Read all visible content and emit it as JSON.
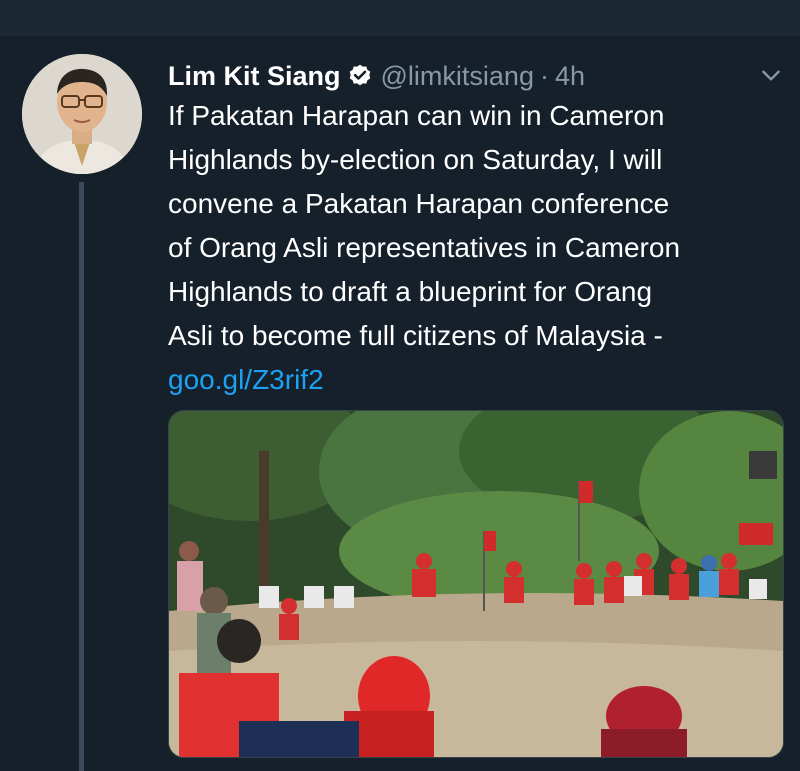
{
  "tweet": {
    "author_name": "Lim Kit Siang",
    "handle": "@limkitsiang",
    "separator": "·",
    "timestamp": "4h",
    "text_lines": [
      "If Pakatan Harapan can win in Cameron",
      "Highlands by-election on Saturday, I will",
      "convene a Pakatan Harapan conference",
      "of Orang Asli representatives in Cameron",
      "Highlands to draft a blueprint for Orang",
      "Asli to become full citizens of Malaysia -"
    ],
    "link": "goo.gl/Z3rif2",
    "icons": {
      "verified": "verified-badge-icon",
      "menu": "chevron-down-icon"
    },
    "colors": {
      "background": "#15202b",
      "text": "#ffffff",
      "muted": "#8899a6",
      "link": "#1da1f2"
    }
  }
}
